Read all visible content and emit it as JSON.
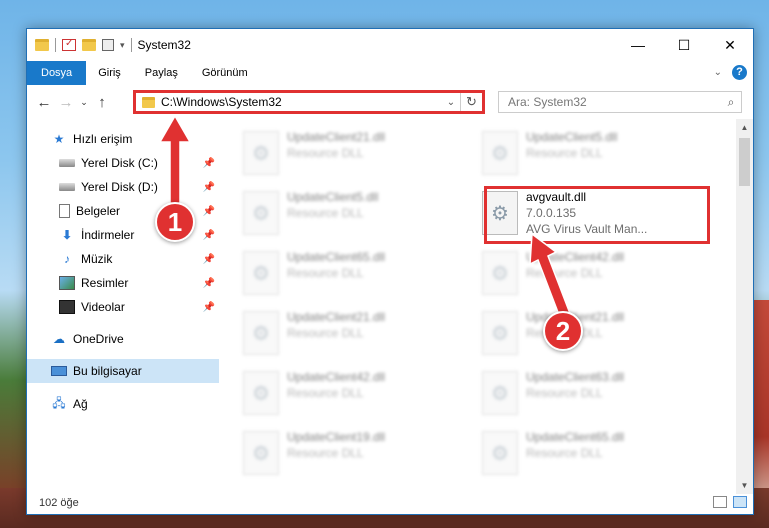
{
  "window": {
    "title": "System32"
  },
  "ribbon": {
    "tabs": [
      {
        "label": "Dosya"
      },
      {
        "label": "Giriş"
      },
      {
        "label": "Paylaş"
      },
      {
        "label": "Görünüm"
      }
    ],
    "help_label": "?"
  },
  "address": {
    "path": "C:\\Windows\\System32"
  },
  "search": {
    "placeholder": "Ara: System32"
  },
  "nav": {
    "items": [
      {
        "label": "Hızlı erişim",
        "icon": "quick-access-icon"
      },
      {
        "label": "Yerel Disk (C:)",
        "icon": "disk-icon"
      },
      {
        "label": "Yerel Disk (D:)",
        "icon": "disk-icon"
      },
      {
        "label": "Belgeler",
        "icon": "documents-icon"
      },
      {
        "label": "İndirmeler",
        "icon": "downloads-icon"
      },
      {
        "label": "Müzik",
        "icon": "music-icon"
      },
      {
        "label": "Resimler",
        "icon": "pictures-icon"
      },
      {
        "label": "Videolar",
        "icon": "videos-icon"
      },
      {
        "label": "OneDrive",
        "icon": "onedrive-icon"
      },
      {
        "label": "Bu bilgisayar",
        "icon": "this-pc-icon"
      },
      {
        "label": "Ağ",
        "icon": "network-icon"
      }
    ]
  },
  "files": [
    {
      "name": "UpdateClient21.dll",
      "sub": "Resource DLL"
    },
    {
      "name": "UpdateClient5.dll",
      "sub": "Resource DLL"
    },
    {
      "name": "UpdateClient5.dll",
      "sub": "Resource DLL"
    },
    {
      "name": "avgvault.dll",
      "version": "7.0.0.135",
      "description": "AVG Virus Vault Man..."
    },
    {
      "name": "UpdateClient65.dll",
      "sub": "Resource DLL"
    },
    {
      "name": "UpdateClient42.dll",
      "sub": "Resource DLL"
    },
    {
      "name": "UpdateClient21.dll",
      "sub": "Resource DLL"
    },
    {
      "name": "UpdateClient21.dll",
      "sub": "Resource DLL"
    },
    {
      "name": "UpdateClient42.dll",
      "sub": "Resource DLL"
    },
    {
      "name": "UpdateClient63.dll",
      "sub": "Resource DLL"
    },
    {
      "name": "UpdateClient19.dll",
      "sub": "Resource DLL"
    },
    {
      "name": "UpdateClient65.dll",
      "sub": "Resource DLL"
    }
  ],
  "status": {
    "item_count": "102 öğe"
  },
  "callouts": [
    {
      "number": "1"
    },
    {
      "number": "2"
    }
  ],
  "colors": {
    "accent": "#1979ca",
    "callout": "#e03131",
    "selected_nav": "#cce4f7"
  }
}
